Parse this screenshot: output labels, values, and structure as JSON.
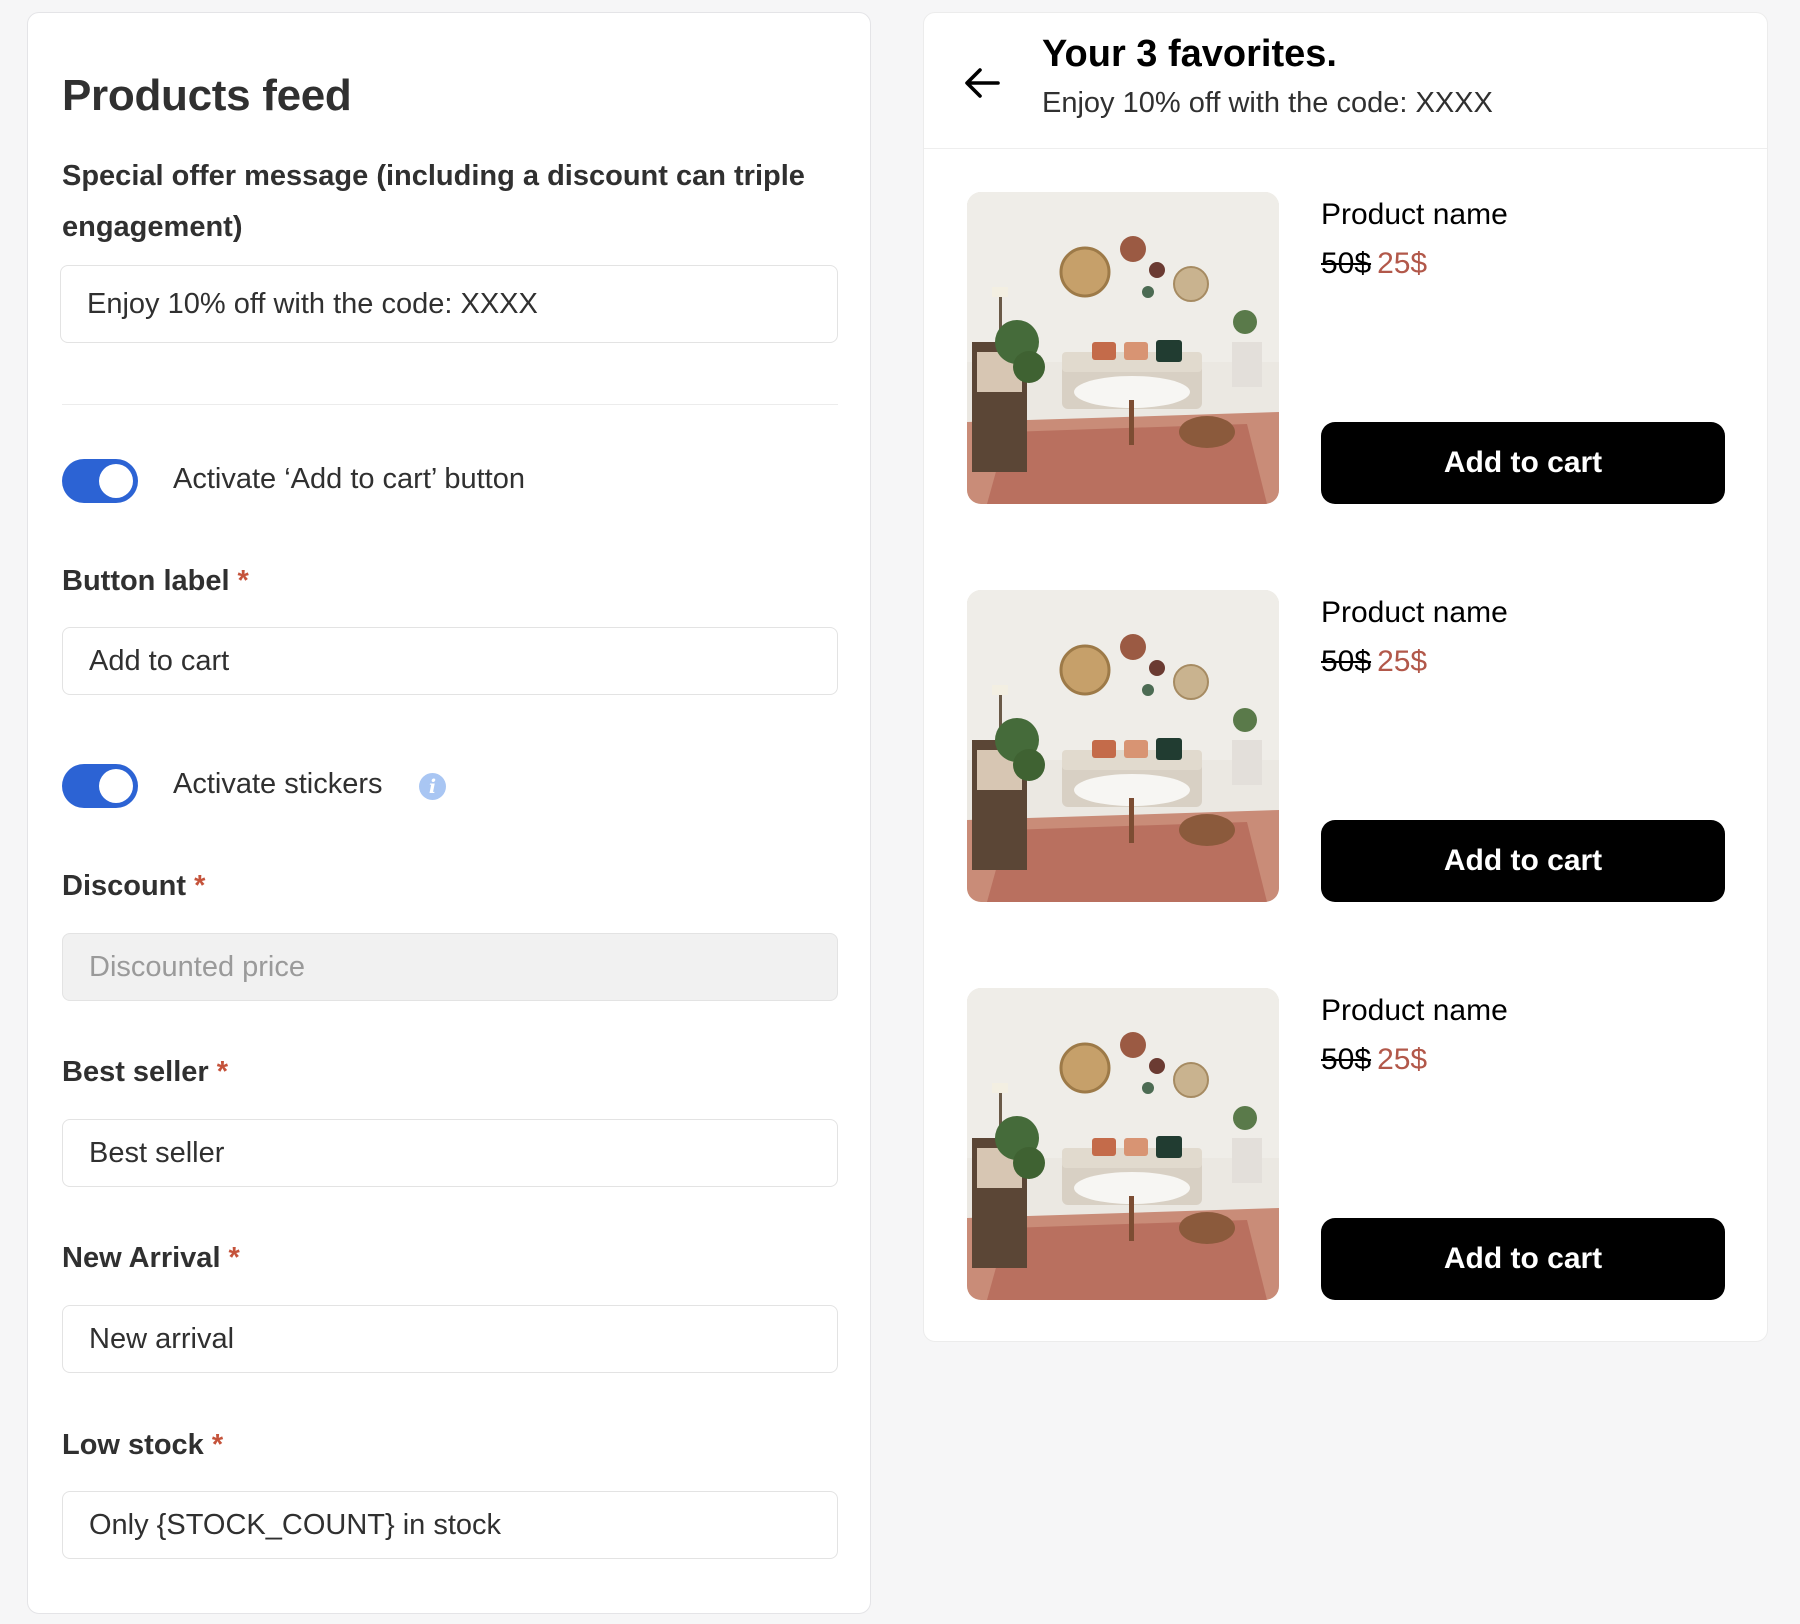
{
  "settings": {
    "title": "Products feed",
    "offer": {
      "label": "Special offer message (including a discount can triple engagement)",
      "value": "Enjoy 10% off with the code: XXXX"
    },
    "add_to_cart_toggle": {
      "label": "Activate ‘Add to cart’ button",
      "enabled": true
    },
    "button_label": {
      "label": "Button label",
      "required_mark": "*",
      "value": "Add to cart"
    },
    "stickers_toggle": {
      "label": "Activate stickers",
      "enabled": true
    },
    "discount": {
      "label": "Discount",
      "required_mark": "*",
      "placeholder": "Discounted price"
    },
    "best_seller": {
      "label": "Best seller",
      "required_mark": "*",
      "value": "Best seller"
    },
    "new_arrival": {
      "label": "New Arrival",
      "required_mark": "*",
      "value": "New arrival"
    },
    "low_stock": {
      "label": "Low stock",
      "required_mark": "*",
      "value": "Only {STOCK_COUNT} in stock"
    }
  },
  "preview": {
    "title": "Your 3 favorites.",
    "subtitle": "Enjoy 10% off with the code: XXXX",
    "products": [
      {
        "name": "Product name",
        "old_price": "50$",
        "new_price": "25$",
        "button": "Add to cart"
      },
      {
        "name": "Product name",
        "old_price": "50$",
        "new_price": "25$",
        "button": "Add to cart"
      },
      {
        "name": "Product name",
        "old_price": "50$",
        "new_price": "25$",
        "button": "Add to cart"
      }
    ]
  },
  "colors": {
    "toggle_on": "#2c63d4",
    "required": "#c5533b",
    "sale_price": "#b2584a",
    "button_bg": "#000000"
  }
}
